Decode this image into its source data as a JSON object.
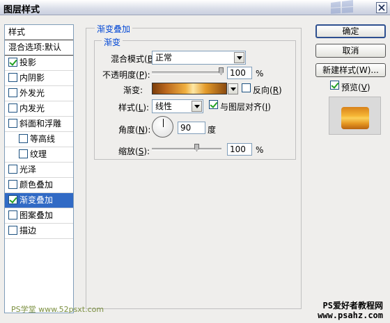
{
  "window": {
    "title": "图层样式"
  },
  "style_list": {
    "header": "样式",
    "blend_options": "混合选项:默认",
    "items": [
      {
        "label": "投影",
        "checked": true,
        "indent": false,
        "selected": false
      },
      {
        "label": "内阴影",
        "checked": false,
        "indent": false,
        "selected": false
      },
      {
        "label": "外发光",
        "checked": false,
        "indent": false,
        "selected": false
      },
      {
        "label": "内发光",
        "checked": false,
        "indent": false,
        "selected": false
      },
      {
        "label": "斜面和浮雕",
        "checked": false,
        "indent": false,
        "selected": false
      },
      {
        "label": "等高线",
        "checked": false,
        "indent": true,
        "selected": false
      },
      {
        "label": "纹理",
        "checked": false,
        "indent": true,
        "selected": false
      },
      {
        "label": "光泽",
        "checked": false,
        "indent": false,
        "selected": false
      },
      {
        "label": "颜色叠加",
        "checked": false,
        "indent": false,
        "selected": false
      },
      {
        "label": "渐变叠加",
        "checked": true,
        "indent": false,
        "selected": true
      },
      {
        "label": "图案叠加",
        "checked": false,
        "indent": false,
        "selected": false
      },
      {
        "label": "描边",
        "checked": false,
        "indent": false,
        "selected": false
      }
    ]
  },
  "panel": {
    "group_title": "渐变叠加",
    "sub_title": "渐变",
    "blend_mode_label": "混合模式(",
    "blend_mode_key": "B",
    "blend_mode_suffix": "):",
    "blend_mode_value": "正常",
    "opacity_label": "不透明度(",
    "opacity_key": "P",
    "opacity_suffix": "):",
    "opacity_value": "100",
    "opacity_unit": "%",
    "opacity_level": 1.0,
    "gradient_label": "渐变:",
    "reverse_label": "反向(",
    "reverse_key": "R",
    "reverse_suffix": ")",
    "reverse_checked": false,
    "style_label": "样式(",
    "style_key": "L",
    "style_suffix": "):",
    "style_value": "线性",
    "align_label": "与图层对齐(",
    "align_key": "I",
    "align_suffix": ")",
    "align_checked": true,
    "angle_label": "角度(",
    "angle_key": "N",
    "angle_suffix": "):",
    "angle_value": "90",
    "angle_unit": "度",
    "scale_label": "缩放(",
    "scale_key": "S",
    "scale_suffix": "):",
    "scale_value": "100",
    "scale_unit": "%",
    "scale_level": 0.65
  },
  "buttons": {
    "ok": "确定",
    "cancel": "取消",
    "new_style": "新建样式(W)...",
    "preview_label": "预览(",
    "preview_key": "V",
    "preview_suffix": ")",
    "preview_checked": true
  },
  "watermarks": {
    "left": "PS学堂 www.52psxt.com",
    "right_line1": "PS爱好者教程网",
    "right_line2": "www.psahz.com"
  }
}
